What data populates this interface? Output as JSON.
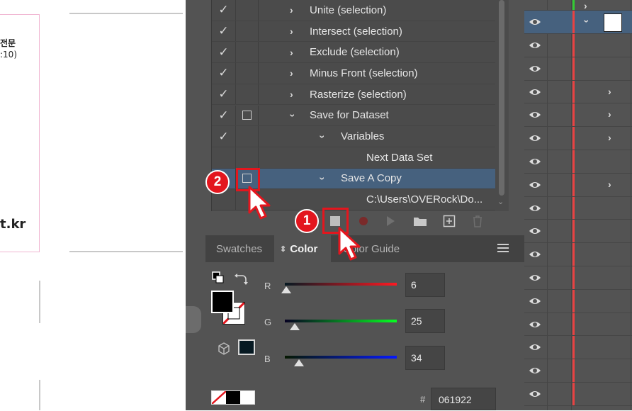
{
  "canvas": {
    "text_line1": "전문",
    "text_line2": ":10)",
    "text_line3": "t.kr"
  },
  "actions": {
    "rows": [
      {
        "label": "Unite (selection)",
        "checked": true,
        "dialog": false
      },
      {
        "label": "Intersect (selection)",
        "checked": true,
        "dialog": false
      },
      {
        "label": "Exclude (selection)",
        "checked": true,
        "dialog": false
      },
      {
        "label": "Minus Front (selection)",
        "checked": true,
        "dialog": false
      },
      {
        "label": "Rasterize (selection)",
        "checked": true,
        "dialog": false
      },
      {
        "label": "Save for Dataset",
        "checked": true,
        "dialog": true
      },
      {
        "label": "Variables",
        "checked": true,
        "dialog": false
      },
      {
        "label": "Next Data Set",
        "checked": false,
        "dialog": false
      },
      {
        "label": "Save A Copy",
        "checked": false,
        "dialog": true
      },
      {
        "label": "C:\\Users\\OVERock\\Do...",
        "checked": false,
        "dialog": false
      }
    ]
  },
  "color_panel": {
    "tabs": [
      "Swatches",
      "Color",
      "Color Guide"
    ],
    "active_tab": "Color",
    "r_label": "R",
    "g_label": "G",
    "b_label": "B",
    "r_value": "6",
    "g_value": "25",
    "b_value": "34",
    "r_level": 0.024,
    "g_level": 0.098,
    "b_level": 0.133,
    "hex_prefix": "#",
    "hex_value": "061922",
    "fill_color": "#000000",
    "out_of_gamut_swatch": "#061922"
  },
  "callouts": {
    "badge1": "1",
    "badge2": "2",
    "color": "#e3161e"
  },
  "icons": {
    "actions_toolbar": [
      "stop-icon",
      "record-icon",
      "play-icon",
      "folder-icon",
      "new-action-icon",
      "trash-icon"
    ]
  }
}
